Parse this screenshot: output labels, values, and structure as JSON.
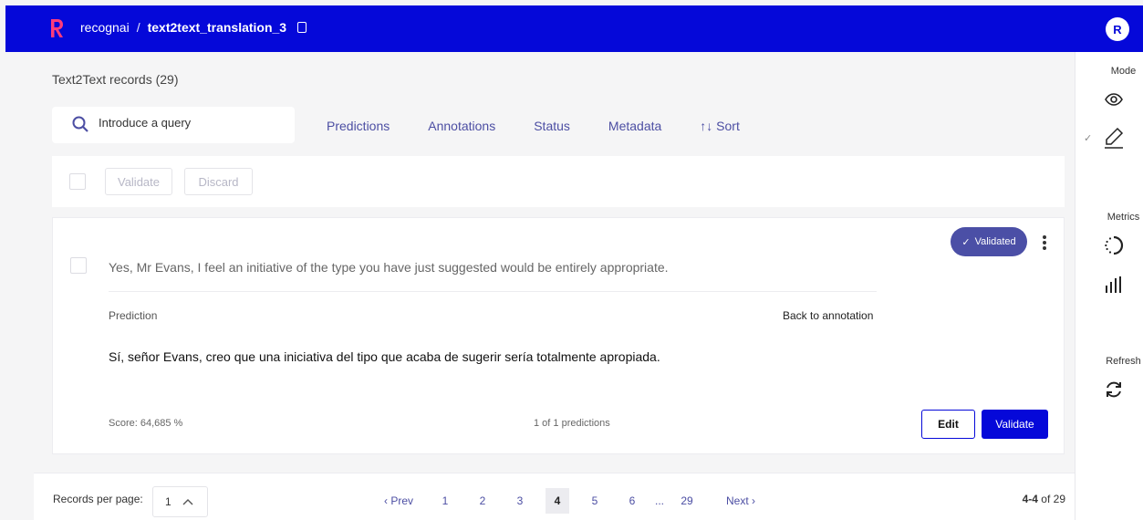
{
  "topbar": {
    "org": "recognai",
    "separator": "/",
    "dataset": "text2text_translation_3",
    "avatar_initial": "R",
    "brand_color": "#0508d9"
  },
  "sidebar": {
    "mode_label": "Mode",
    "metrics_label": "Metrics",
    "refresh_label": "Refresh",
    "icons": [
      "eye-icon",
      "pencil-icon",
      "progress-ring-icon",
      "bar-chart-icon",
      "refresh-icon"
    ]
  },
  "main": {
    "title": "Text2Text records (29)",
    "search_placeholder": "Introduce a query",
    "filters": [
      "Predictions",
      "Annotations",
      "Status",
      "Metadata",
      "↑↓ Sort"
    ],
    "bulk": {
      "validate": "Validate",
      "discard": "Discard"
    }
  },
  "record": {
    "text": "Yes, Mr Evans, I feel an initiative of the type you have just suggested would be entirely appropriate.",
    "status": "Validated",
    "prediction_label": "Prediction",
    "back_link": "Back to annotation",
    "prediction_text": "Sí, señor Evans, creo que una iniciativa del tipo que acaba de sugerir sería totalmente apropiada.",
    "score": "Score: 64,685 %",
    "predictions_count": "1 of 1 predictions",
    "edit": "Edit",
    "validate": "Validate"
  },
  "footer": {
    "rpp_label": "Records per page:",
    "rpp_value": "1",
    "prev": "‹ Prev",
    "next": "Next ›",
    "pages": [
      "1",
      "2",
      "3",
      "4",
      "5",
      "6",
      "...",
      "29"
    ],
    "current_page": "4",
    "range": "4-4",
    "of_total": "of 29"
  }
}
